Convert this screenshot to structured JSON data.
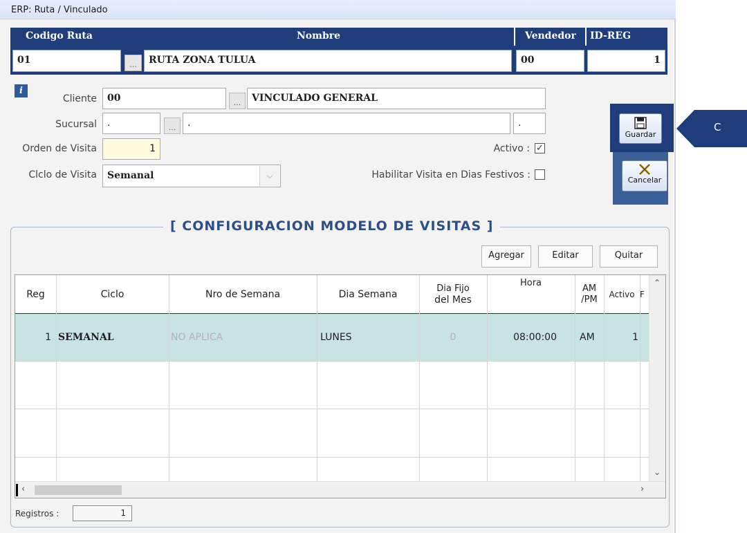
{
  "window": {
    "title": "ERP: Ruta / Vinculado"
  },
  "header": {
    "col_codigo": "Codigo Ruta",
    "col_nombre": "Nombre",
    "col_vendedor": "Vendedor",
    "col_idreg": "ID-REG",
    "codigo_value": "01",
    "nombre_value": "RUTA ZONA TULUA",
    "vendedor_value": "00",
    "idreg_value": "1",
    "lookup_dots": "..."
  },
  "form": {
    "info_icon": "i",
    "cliente_label": "Cliente",
    "cliente_code": "00",
    "cliente_name": "VINCULADO GENERAL",
    "sucursal_label": "Sucursal",
    "sucursal_code": ".",
    "sucursal_name": ".",
    "sucursal_extra": ".",
    "orden_label": "Orden de Visita",
    "orden_value": "1",
    "ciclo_label": "Clclo de Visita",
    "ciclo_value": "Semanal",
    "activo_label": "Activo :",
    "activo_checked": true,
    "festivos_label": "Habilitar Visita en Dias Festivos :",
    "festivos_checked": false
  },
  "side_buttons": {
    "guardar": "Guardar",
    "cancelar": "Cancelar"
  },
  "group": {
    "title": "[  CONFIGURACION MODELO DE VISITAS  ]",
    "btn_agregar": "Agregar",
    "btn_editar": "Editar",
    "btn_quitar": "Quitar"
  },
  "grid": {
    "columns": {
      "reg": "Reg",
      "ciclo": "Ciclo",
      "nro_semana": "Nro de Semana",
      "dia_semana": "Dia Semana",
      "dia_fijo_1": "Dia Fijo",
      "dia_fijo_2": "del Mes",
      "hora": "Hora",
      "ampm_1": "AM",
      "ampm_2": "/PM",
      "activo": "Activo",
      "extra": "F"
    },
    "row": {
      "reg": "1",
      "ciclo": "SEMANAL",
      "nro_semana": "NO APLICA",
      "dia_semana": "LUNES",
      "dia_fijo": "0",
      "hora": "08:00:00",
      "ampm": "AM",
      "activo": "1"
    }
  },
  "status": {
    "registros_label": "Registros :",
    "registros_value": "1"
  },
  "callout": {
    "label": "C",
    "color": "#1f3d7a"
  },
  "colors": {
    "header_bg": "#1f3d7a",
    "row_selected": "#c9e3e3",
    "side_panel": "#3b5f97",
    "orden_bg": "#fffbdc"
  }
}
